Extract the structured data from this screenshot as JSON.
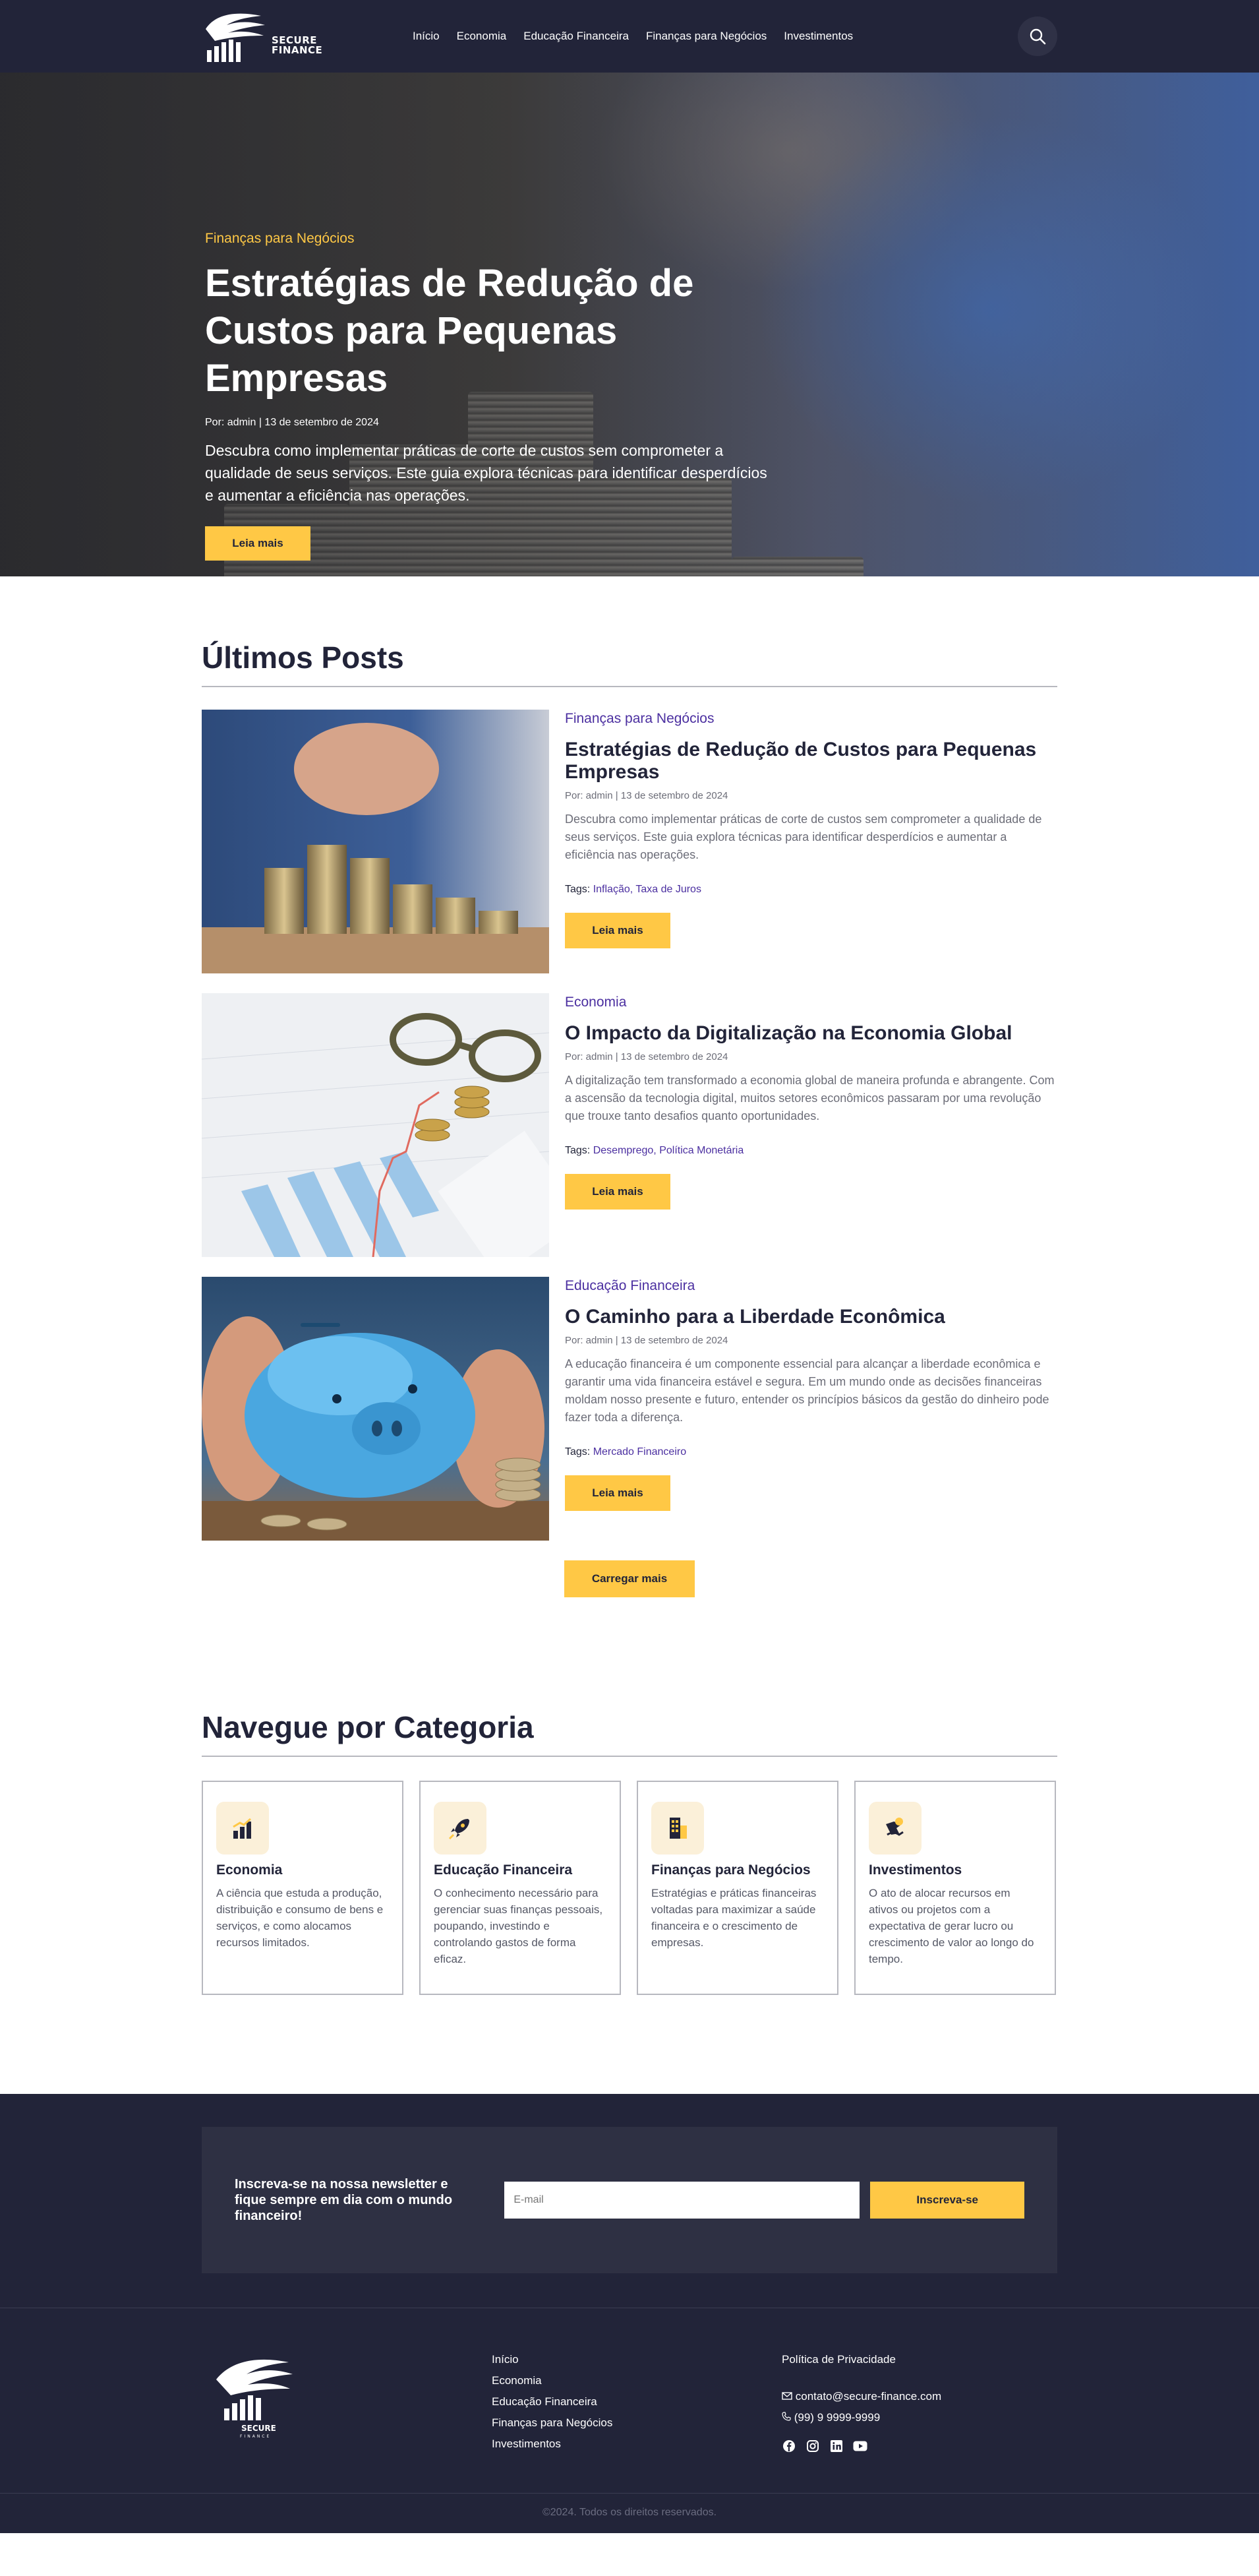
{
  "header": {
    "logo_text_1": "SECURE",
    "logo_text_2": "FINANCE",
    "nav": [
      "Início",
      "Economia",
      "Educação Financeira",
      "Finanças para Negócios",
      "Investimentos"
    ]
  },
  "hero": {
    "category": "Finanças para Negócios",
    "title": "Estratégias de Redução de Custos para Pequenas Empresas",
    "meta": "Por: admin | 13 de setembro de 2024",
    "description": "Descubra como implementar práticas de corte de custos sem comprometer a qualidade de seus serviços. Este guia explora técnicas para identificar desperdícios e aumentar a eficiência nas operações.",
    "button": "Leia mais"
  },
  "posts_section": {
    "title": "Últimos Posts",
    "posts": [
      {
        "category": "Finanças para Negócios",
        "title": "Estratégias de Redução de Custos para Pequenas Empresas",
        "meta": "Por: admin | 13 de setembro de 2024",
        "description": "Descubra como implementar práticas de corte de custos sem comprometer a qualidade de seus serviços. Este guia explora técnicas para identificar desperdícios e aumentar a eficiência nas operações.",
        "tags_label": "Tags:",
        "tags": "Inflação, Taxa de Juros",
        "button": "Leia mais"
      },
      {
        "category": "Economia",
        "title": "O Impacto da Digitalização na Economia Global",
        "meta": "Por: admin | 13 de setembro de 2024",
        "description": "A digitalização tem transformado a economia global de maneira profunda e abrangente. Com a ascensão da tecnologia digital, muitos setores econômicos passaram por uma revolução que trouxe tanto desafios quanto oportunidades.",
        "tags_label": "Tags:",
        "tags": "Desemprego, Política Monetária",
        "button": "Leia mais"
      },
      {
        "category": "Educação Financeira",
        "title": "O Caminho para a Liberdade Econômica",
        "meta": "Por: admin | 13 de setembro de 2024",
        "description": "A educação financeira é um componente essencial para alcançar a liberdade econômica e garantir uma vida financeira estável e segura. Em um mundo onde as decisões financeiras moldam nosso presente e futuro, entender os princípios básicos da gestão do dinheiro pode fazer toda a diferença.",
        "tags_label": "Tags:",
        "tags": "Mercado Financeiro",
        "button": "Leia mais"
      }
    ],
    "load_more": "Carregar mais"
  },
  "categories_section": {
    "title": "Navegue por Categoria",
    "items": [
      {
        "name": "Economia",
        "description": "A ciência que estuda a produção, distribuição e consumo de bens e serviços, e como alocamos recursos limitados.",
        "icon": "bar-chart-icon"
      },
      {
        "name": "Educação Financeira",
        "description": "O conhecimento necessário para gerenciar suas finanças pessoais, poupando, investindo e controlando gastos de forma eficaz.",
        "icon": "rocket-icon"
      },
      {
        "name": "Finanças para Negócios",
        "description": "Estratégias e práticas financeiras voltadas para maximizar a saúde financeira e o crescimento de empresas.",
        "icon": "building-icon"
      },
      {
        "name": "Investimentos",
        "description": "O ato de alocar recursos em ativos ou projetos com a expectativa de gerar lucro ou crescimento de valor ao longo do tempo.",
        "icon": "money-hand-icon"
      }
    ]
  },
  "newsletter": {
    "text": "Inscreva-se na nossa newsletter e fique sempre em dia com o mundo financeiro!",
    "placeholder": "E-mail",
    "button": "Inscreva-se"
  },
  "footer": {
    "logo_text_1": "SECURE",
    "logo_text_2": "FINANCE",
    "links": [
      "Início",
      "Economia",
      "Educação Financeira",
      "Finanças para Negócios",
      "Investimentos"
    ],
    "policy": "Política de Privacidade",
    "email": "contato@secure-finance.com",
    "phone": "(99) 9 9999-9999",
    "copyright": "©2024. Todos os direitos reservados."
  },
  "colors": {
    "navy": "#222439",
    "accent_yellow": "#ffc845",
    "link_purple": "#4b2fa0"
  }
}
